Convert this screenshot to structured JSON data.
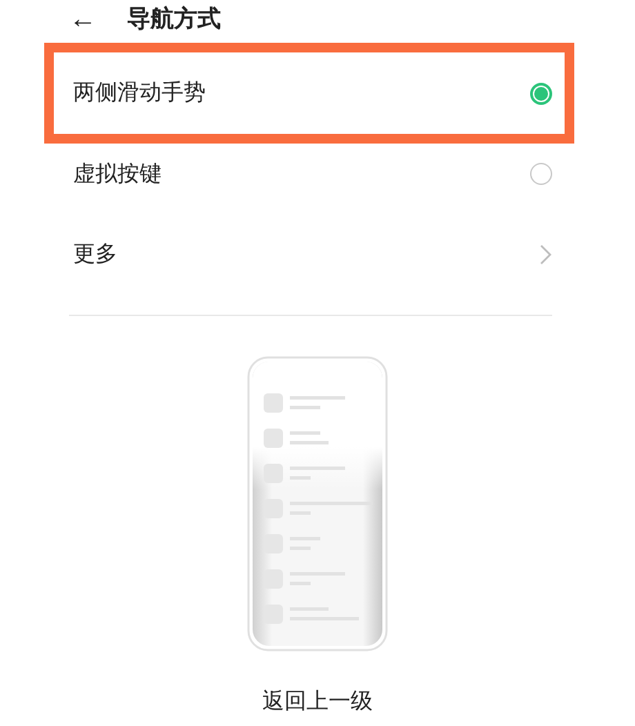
{
  "header": {
    "back": "←",
    "title": "导航方式"
  },
  "options": [
    {
      "kind": "radio",
      "label": "两侧滑动手势",
      "selected": true,
      "highlighted": true
    },
    {
      "kind": "radio",
      "label": "虚拟按键",
      "selected": false,
      "highlighted": false
    },
    {
      "kind": "link",
      "label": "更多",
      "highlighted": false
    }
  ],
  "preview": {
    "caption": "返回上一级"
  }
}
